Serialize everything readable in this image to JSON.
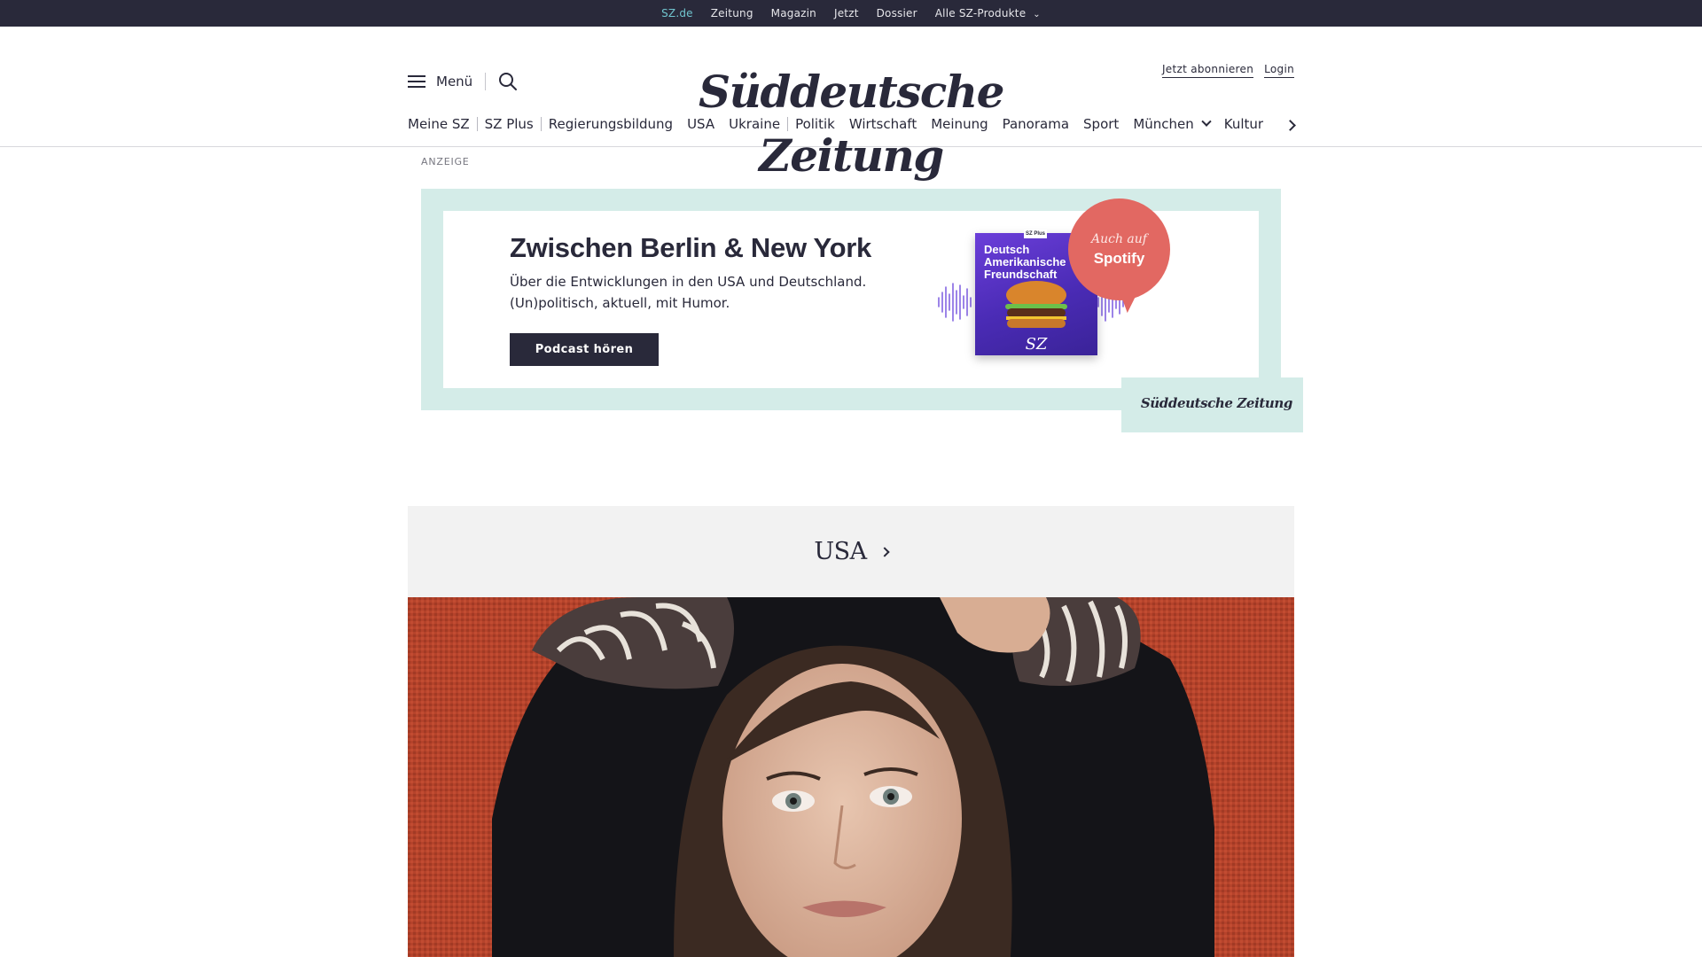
{
  "topbar": {
    "links": [
      {
        "label": "SZ.de",
        "active": true
      },
      {
        "label": "Zeitung",
        "active": false
      },
      {
        "label": "Magazin",
        "active": false
      },
      {
        "label": "Jetzt",
        "active": false
      },
      {
        "label": "Dossier",
        "active": false
      },
      {
        "label": "Alle SZ-Produkte",
        "active": false,
        "has_dropdown": true
      }
    ]
  },
  "header": {
    "menu_label": "Menü",
    "logo": "Süddeutsche Zeitung",
    "subscribe_label": "Jetzt abonnieren",
    "login_label": "Login"
  },
  "nav": {
    "items": [
      "Meine SZ",
      "SZ Plus",
      "Regierungsbildung",
      "USA",
      "Ukraine",
      "Politik",
      "Wirtschaft",
      "Meinung",
      "Panorama",
      "Sport",
      "München",
      "Kultur"
    ]
  },
  "ad": {
    "label": "ANZEIGE",
    "title": "Zwischen Berlin & New York",
    "subtitle": "Über die Entwicklungen in den USA und Deutschland. (Un)politisch, aktuell, mit Humor.",
    "cta": "Podcast hören",
    "cover_badge": "SZ Plus",
    "cover_title": "Deutsch Amerikanische Freundschaft",
    "cover_logo": "SZ",
    "bubble_top": "Auch auf",
    "bubble_main": "Spotify",
    "brand": "Süddeutsche Zeitung",
    "colors": {
      "frame": "#d4ece8",
      "cover": "#5a34c8",
      "bubble": "#e26862"
    }
  },
  "section": {
    "title": "USA"
  },
  "icons": {
    "menu": "hamburger-icon",
    "search": "search-icon",
    "nav_more": "chevron-right-icon"
  },
  "colors": {
    "topbar_bg": "#29293a",
    "topbar_active": "#71c5cf",
    "text": "#29293a"
  }
}
